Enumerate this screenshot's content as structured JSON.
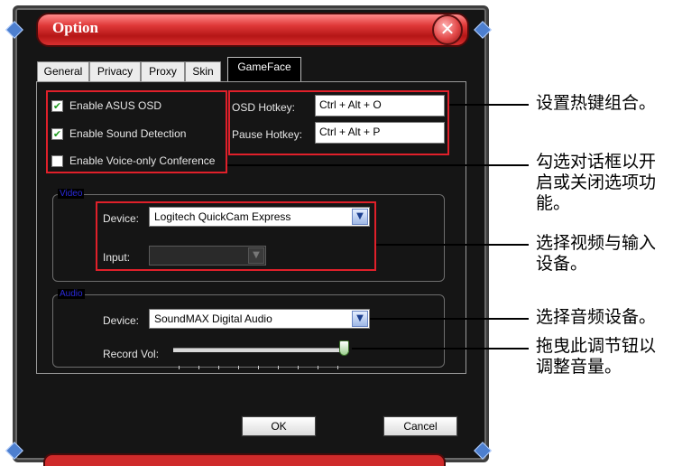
{
  "window": {
    "title": "Option"
  },
  "tabs": [
    {
      "label": "General",
      "active": false
    },
    {
      "label": "Privacy",
      "active": false
    },
    {
      "label": "Proxy",
      "active": false
    },
    {
      "label": "Skin",
      "active": false
    },
    {
      "label": "GameFace",
      "active": true
    }
  ],
  "options": [
    {
      "label": "Enable ASUS OSD",
      "checked": true
    },
    {
      "label": "Enable Sound Detection",
      "checked": true
    },
    {
      "label": "Enable Voice-only Conference",
      "checked": false
    }
  ],
  "hotkeys": {
    "osd_label": "OSD Hotkey:",
    "osd_value": "Ctrl + Alt + O",
    "pause_label": "Pause Hotkey:",
    "pause_value": "Ctrl + Alt + P"
  },
  "video": {
    "group_title": "Video",
    "device_label": "Device:",
    "device_value": "Logitech QuickCam Express",
    "input_label": "Input:",
    "input_value": ""
  },
  "audio": {
    "group_title": "Audio",
    "device_label": "Device:",
    "device_value": "SoundMAX Digital Audio",
    "record_label": "Record Vol:",
    "record_level": 1.0
  },
  "buttons": {
    "ok": "OK",
    "cancel": "Cancel"
  },
  "callouts": {
    "hotkey": "设置热键组合。",
    "checkbox_1": "勾选对话框以开",
    "checkbox_2": "启或关闭选项功",
    "checkbox_3": "能。",
    "video_1": "选择视频与输入",
    "video_2": "设备。",
    "audio": "选择音频设备。",
    "volume_1": "拖曳此调节钮以",
    "volume_2": "调整音量。"
  },
  "colors": {
    "titlebar": "#d83030",
    "highlight": "#e0202a",
    "accent_blue": "#4d7fcf",
    "check": "#1f9a1f"
  },
  "icons": {
    "close": "close-icon",
    "dropdown": "chevron-down-icon",
    "check": "check-icon"
  }
}
